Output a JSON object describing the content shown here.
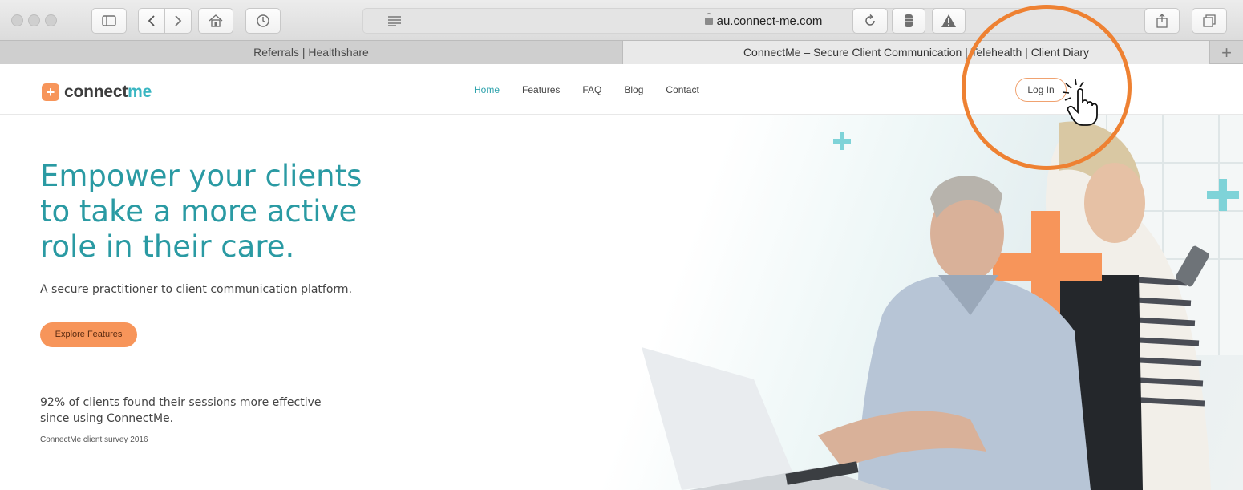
{
  "browser": {
    "url": "au.connect-me.com",
    "tabs": [
      {
        "label": "Referrals | Healthshare"
      },
      {
        "label": "ConnectMe – Secure Client Communication | Telehealth | Client Diary"
      }
    ],
    "new_tab_label": "+"
  },
  "site": {
    "logo_icon": "+",
    "logo_part1": "connect",
    "logo_part2": "me",
    "nav": [
      {
        "label": "Home",
        "active": true
      },
      {
        "label": "Features"
      },
      {
        "label": "FAQ"
      },
      {
        "label": "Blog"
      },
      {
        "label": "Contact"
      }
    ],
    "login_label": "Log In"
  },
  "hero": {
    "title": "Empower your clients to take a more active role in their care.",
    "subtitle": "A secure practitioner to client communication platform.",
    "cta_label": "Explore Features",
    "stat": "92% of clients found their sessions more effective since using ConnectMe.",
    "source": "ConnectMe client survey 2016",
    "image_description": "man at laptop, woman with phone, orange plus shape"
  },
  "colors": {
    "teal": "#2a9aa3",
    "orange": "#f7955a",
    "ring": "#ee8132"
  },
  "icons": [
    "sidebar-icon",
    "back-icon",
    "forward-icon",
    "home-icon",
    "history-icon",
    "reader-icon",
    "lock-icon",
    "reload-icon",
    "extension-icon",
    "warning-icon",
    "share-icon",
    "tabs-icon",
    "hand-cursor-icon"
  ]
}
